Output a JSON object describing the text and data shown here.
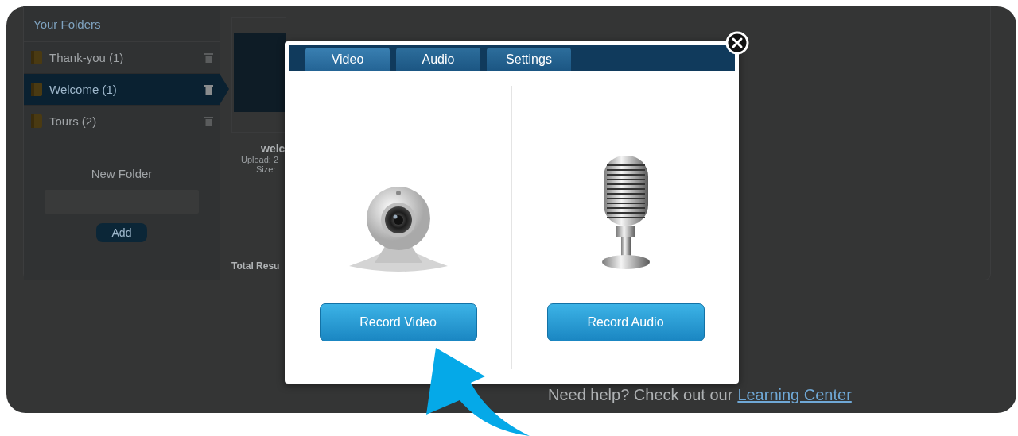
{
  "sidebar": {
    "title": "Your Folders",
    "folders": [
      {
        "name": "Thank-you",
        "count": "(1)",
        "selected": false
      },
      {
        "name": "Welcome",
        "count": "(1)",
        "selected": true
      },
      {
        "name": "Tours",
        "count": "(2)",
        "selected": false
      }
    ],
    "new_folder": {
      "label": "New Folder",
      "button": "Add"
    }
  },
  "media_card": {
    "title": "welc",
    "upload": "Upload: 2",
    "size": "Size:"
  },
  "total": "Total Resu",
  "help": {
    "text": "Need help? Check out our",
    "link": "Learning Center"
  },
  "modal": {
    "tabs": [
      {
        "label": "Video",
        "selected": true
      },
      {
        "label": "Audio",
        "selected": false
      },
      {
        "label": "Settings",
        "selected": false
      }
    ],
    "panels": [
      {
        "kind": "video",
        "button": "Record Video"
      },
      {
        "kind": "audio",
        "button": "Record Audio"
      }
    ]
  }
}
